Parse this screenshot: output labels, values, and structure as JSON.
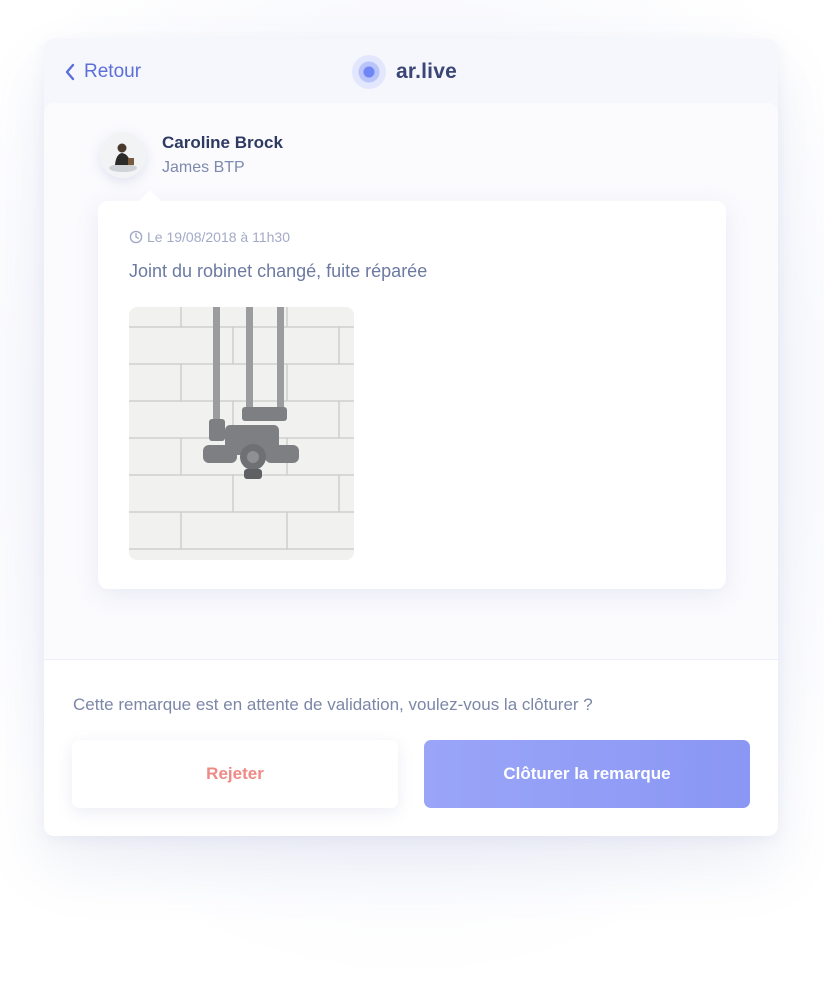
{
  "header": {
    "back_label": "Retour",
    "brand_name": "ar.live"
  },
  "author": {
    "name": "Caroline Brock",
    "company": "James BTP"
  },
  "note": {
    "timestamp": "Le 19/08/2018 à 11h30",
    "text": "Joint du robinet changé, fuite réparée"
  },
  "footer": {
    "question": "Cette remarque est en attente de validation, voulez-vous la clôturer ?",
    "reject_label": "Rejeter",
    "close_label": "Clôturer la remarque"
  },
  "colors": {
    "accent": "#5c6fd8",
    "primary_button": "#8f9bf6",
    "reject_text": "#ee8a86"
  },
  "icons": [
    "chevron-left-icon",
    "brand-logo-icon",
    "clock-icon"
  ]
}
